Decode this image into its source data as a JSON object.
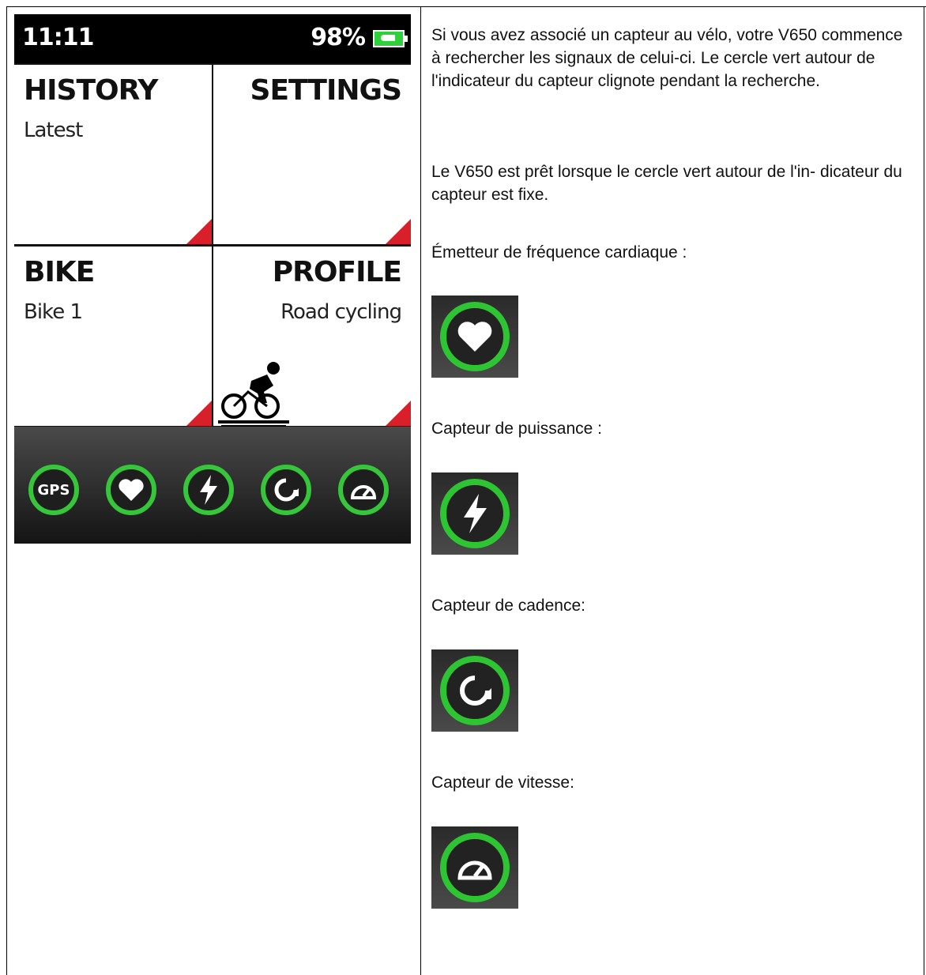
{
  "device": {
    "status": {
      "time": "11:11",
      "battery": "98%"
    },
    "tiles": [
      {
        "title": "HISTORY",
        "subtitle": "Latest"
      },
      {
        "title": "SETTINGS",
        "subtitle": ""
      },
      {
        "title": "BIKE",
        "subtitle": "Bike 1"
      },
      {
        "title": "PROFILE",
        "subtitle": "Road cycling"
      }
    ],
    "sensors": {
      "gps_label": "GPS"
    },
    "colors": {
      "accent_green": "#35c63a",
      "corner_red": "#d81f2a"
    }
  },
  "text": {
    "p1": "Si vous avez associé un capteur au vélo, votre V650 commence à rechercher les signaux de celui-ci. Le cercle vert autour de l'indicateur du capteur clignote pendant la recherche.",
    "p2": "Le V650 est prêt lorsque le cercle vert autour de l'in- dicateur du capteur est fixe.",
    "heart_label": "Émetteur de fréquence cardiaque :",
    "power_label": "Capteur de puissance :",
    "cadence_label": "Capteur de cadence:",
    "speed_label": "Capteur de vitesse:"
  },
  "icons": [
    "heart-icon",
    "power-icon",
    "cadence-icon",
    "speed-icon"
  ]
}
